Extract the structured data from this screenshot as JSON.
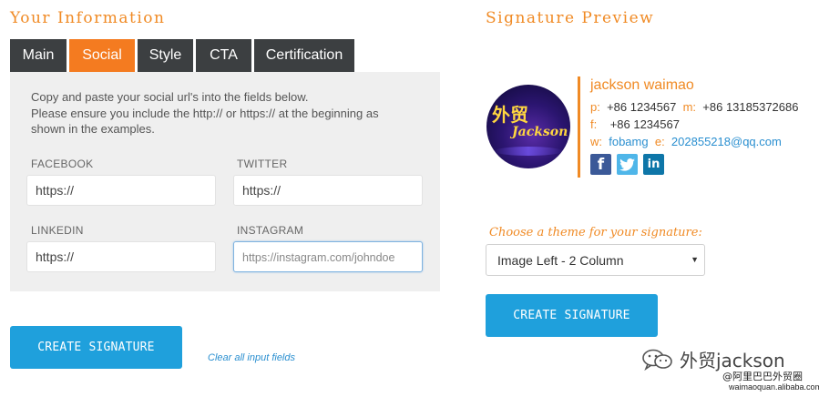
{
  "left": {
    "title": "Your Information",
    "tabs": [
      {
        "label": "Main",
        "active": false
      },
      {
        "label": "Social",
        "active": true
      },
      {
        "label": "Style",
        "active": false
      },
      {
        "label": "CTA",
        "active": false
      },
      {
        "label": "Certification",
        "active": false
      }
    ],
    "instructions": [
      "Copy and paste your social url's into the fields below.",
      "Please ensure you include the http:// or https:// at the beginning as",
      "shown in the examples."
    ],
    "fields": {
      "facebook": {
        "label": "FACEBOOK",
        "value": "https://"
      },
      "twitter": {
        "label": "TWITTER",
        "value": "https://"
      },
      "linkedin": {
        "label": "LINKEDIN",
        "value": "https://"
      },
      "instagram": {
        "label": "INSTAGRAM",
        "value": "",
        "placeholder": "https://instagram.com/johndoe"
      }
    },
    "create_button": "CREATE SIGNATURE",
    "clear_link": "Clear all input fields"
  },
  "right": {
    "title": "Signature Preview",
    "avatar": {
      "text_cn": "外贸",
      "text_en": "Jackson"
    },
    "signature": {
      "name": "jackson waimao",
      "phone_label": "p:",
      "phone": "+86 1234567",
      "mobile_label": "m:",
      "mobile": "+86 13185372686",
      "fax_label": "f:",
      "fax": "+86 1234567",
      "web_label": "w:",
      "web": "fobamg",
      "email_label": "e:",
      "email": "202855218@qq.com"
    },
    "social_icons": [
      {
        "icon": "facebook-icon",
        "glyph": "f",
        "color": "#3b5998"
      },
      {
        "icon": "twitter-icon",
        "color": "#4fb6e9"
      },
      {
        "icon": "linkedin-icon",
        "glyph": "in",
        "color": "#0e76a8"
      }
    ],
    "theme_label": "Choose a theme for your signature:",
    "theme_value": "Image Left - 2 Column",
    "create_button": "CREATE SIGNATURE"
  },
  "watermark": {
    "title": "外贸jackson",
    "sub1": "@阿里巴巴外贸圈",
    "sub2": "waimaoquan.alibaba.com"
  },
  "colors": {
    "accent": "#f08a24",
    "active_tab": "#f47b20",
    "tab": "#3c3f41",
    "button": "#1fa0dc",
    "link": "#2a8fd0"
  }
}
